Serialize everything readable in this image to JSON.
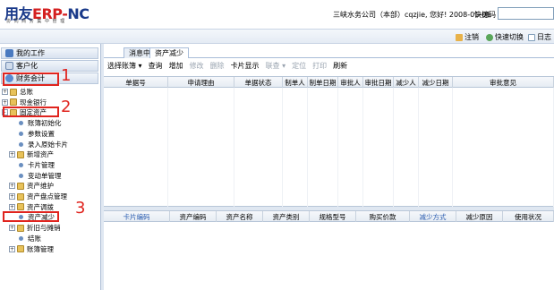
{
  "header": {
    "logo_main_prefix": "用友",
    "logo_main_erp": "ERP-",
    "logo_main_nc": "NC",
    "logo_sub": "协 同 商 务   集 中 管 理",
    "user_info": "三峡水务公司（本部）cqzjie, 您好! 2008-01-01",
    "shortcut_label": "快捷码",
    "shortcut_value": ""
  },
  "toolbar2": {
    "logout": "注销",
    "quick_switch": "快速切换",
    "log": "日志"
  },
  "left_nav": {
    "my_work": "我的工作",
    "customize": "客户化",
    "finance": "财务会计"
  },
  "tree": [
    {
      "label": "总账",
      "expand": "+",
      "type": "folder"
    },
    {
      "label": "现金银行",
      "expand": "+",
      "type": "folder"
    },
    {
      "label": "固定资产",
      "expand": "-",
      "type": "folder"
    },
    {
      "label": "账簿初始化",
      "expand": "",
      "type": "leaf"
    },
    {
      "label": "参数设置",
      "expand": "",
      "type": "leaf"
    },
    {
      "label": "录入原始卡片",
      "expand": "",
      "type": "leaf"
    },
    {
      "label": "新增资产",
      "expand": "+",
      "type": "folder"
    },
    {
      "label": "卡片管理",
      "expand": "",
      "type": "leaf"
    },
    {
      "label": "变动单管理",
      "expand": "",
      "type": "leaf"
    },
    {
      "label": "资产维护",
      "expand": "+",
      "type": "folder"
    },
    {
      "label": "资产盘点管理",
      "expand": "+",
      "type": "folder"
    },
    {
      "label": "资产调拨",
      "expand": "+",
      "type": "folder"
    },
    {
      "label": "资产减少",
      "expand": "",
      "type": "leaf"
    },
    {
      "label": "折旧与摊销",
      "expand": "+",
      "type": "folder"
    },
    {
      "label": "结账",
      "expand": "",
      "type": "leaf"
    },
    {
      "label": "账簿管理",
      "expand": "+",
      "type": "folder"
    }
  ],
  "tabs": [
    "消息中心",
    "资产减少"
  ],
  "actions": [
    {
      "label": "选择账簿 ▾",
      "enabled": true
    },
    {
      "label": "查询",
      "enabled": true
    },
    {
      "label": "增加",
      "enabled": true
    },
    {
      "label": "修改",
      "enabled": false
    },
    {
      "label": "删除",
      "enabled": false
    },
    {
      "label": "卡片显示",
      "enabled": true
    },
    {
      "label": "联查 ▾",
      "enabled": false
    },
    {
      "label": "定位",
      "enabled": false
    },
    {
      "label": "打印",
      "enabled": false
    },
    {
      "label": "刷新",
      "enabled": true
    }
  ],
  "grid1_headers": [
    "单据号",
    "申请理由",
    "单据状态",
    "制单人",
    "制单日期",
    "审批人",
    "审批日期",
    "减少人",
    "减少日期",
    "审批意见"
  ],
  "grid2_headers": [
    "卡片编码",
    "资产编码",
    "资产名称",
    "资产类别",
    "规格型号",
    "购买价款",
    "减少方式",
    "减少原因",
    "使用状况"
  ],
  "annotations": [
    "1",
    "2",
    "3"
  ],
  "colors": {
    "annotation": "#e0241e",
    "logo_blue": "#1a3a8a",
    "logo_red": "#d42020",
    "header_link_blue": "#2a5cb0"
  }
}
